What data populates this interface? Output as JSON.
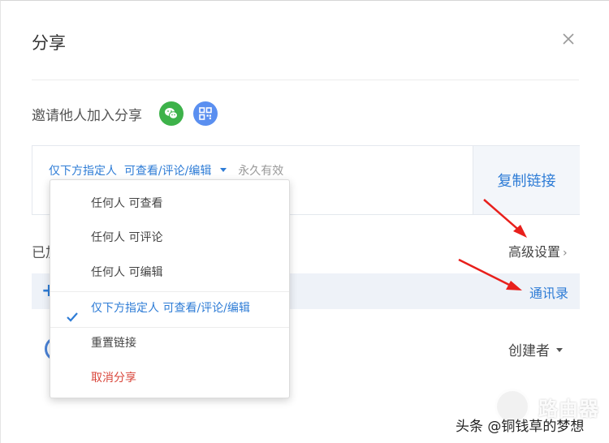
{
  "dialog": {
    "title": "分享",
    "invite_label": "邀请他人加入分享",
    "share_link": {
      "audience": "仅下方指定人",
      "permission": "可查看/评论/编辑",
      "validity": "永久有效",
      "copy_button": "复制链接"
    },
    "added_label": "已加",
    "advanced_settings": "高级设置",
    "contacts_button": "通讯录",
    "member": {
      "role": "创建者"
    }
  },
  "dropdown": {
    "items": [
      {
        "label": "任何人 可查看",
        "selected": false
      },
      {
        "label": "任何人 可评论",
        "selected": false
      },
      {
        "label": "任何人 可编辑",
        "selected": false
      },
      {
        "label": "仅下方指定人 可查看/评论/编辑",
        "selected": true
      },
      {
        "label": "重置链接",
        "selected": false
      },
      {
        "label": "取消分享",
        "selected": false
      }
    ]
  },
  "watermark": {
    "brand": "路由器",
    "caption": "头条 @铜钱草的梦想"
  },
  "colors": {
    "accent": "#2e7cd6",
    "danger": "#d9463b",
    "wechat": "#3db24a",
    "qr": "#5a8ff0",
    "annotation_arrow": "#e8201c"
  },
  "icons": [
    "close-icon",
    "wechat-icon",
    "qr-code-icon",
    "caret-down-icon",
    "chevron-right-icon",
    "plus-icon",
    "checkmark-icon",
    "avatar-icon"
  ]
}
